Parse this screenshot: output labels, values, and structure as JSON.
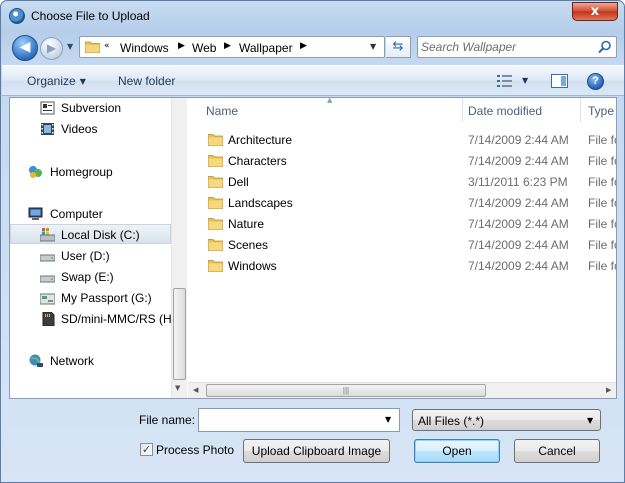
{
  "window": {
    "title": "Choose File to Upload",
    "close_label": "x"
  },
  "address": {
    "overflow": "«",
    "breadcrumbs": [
      "Windows",
      "Web",
      "Wallpaper"
    ],
    "search_placeholder": "Search Wallpaper"
  },
  "toolbar": {
    "organize_label": "Organize",
    "new_folder_label": "New folder",
    "help_label": "?"
  },
  "nav": {
    "items": [
      {
        "label": "Subversion",
        "icon": "subversion-icon"
      },
      {
        "label": "Videos",
        "icon": "videos-icon"
      },
      {
        "label": "Homegroup",
        "icon": "homegroup-icon"
      },
      {
        "label": "Computer",
        "icon": "computer-icon"
      },
      {
        "label": "Local Disk (C:)",
        "icon": "local-disk-icon",
        "selected": true
      },
      {
        "label": "User (D:)",
        "icon": "drive-icon"
      },
      {
        "label": "Swap (E:)",
        "icon": "drive-icon"
      },
      {
        "label": "My Passport (G:)",
        "icon": "external-drive-icon"
      },
      {
        "label": "SD/mini-MMC/RS (H",
        "icon": "sd-card-icon"
      },
      {
        "label": "Network",
        "icon": "network-icon"
      }
    ]
  },
  "files": {
    "columns": {
      "name": "Name",
      "date": "Date modified",
      "type": "Type"
    },
    "rows": [
      {
        "name": "Architecture",
        "date": "7/14/2009 2:44 AM",
        "type": "File fo"
      },
      {
        "name": "Characters",
        "date": "7/14/2009 2:44 AM",
        "type": "File fo"
      },
      {
        "name": "Dell",
        "date": "3/11/2011 6:23 PM",
        "type": "File fo"
      },
      {
        "name": "Landscapes",
        "date": "7/14/2009 2:44 AM",
        "type": "File fo"
      },
      {
        "name": "Nature",
        "date": "7/14/2009 2:44 AM",
        "type": "File fo"
      },
      {
        "name": "Scenes",
        "date": "7/14/2009 2:44 AM",
        "type": "File fo"
      },
      {
        "name": "Windows",
        "date": "7/14/2009 2:44 AM",
        "type": "File fo"
      }
    ]
  },
  "bottom": {
    "file_name_label": "File name:",
    "file_name_value": "",
    "file_type_value": "All Files (*.*)",
    "process_photo_label": "Process Photo",
    "process_photo_checked": true,
    "upload_clipboard_label": "Upload Clipboard Image",
    "open_label": "Open",
    "cancel_label": "Cancel"
  },
  "colors": {
    "folder": "#e8c25a",
    "accent": "#2b66b5"
  }
}
